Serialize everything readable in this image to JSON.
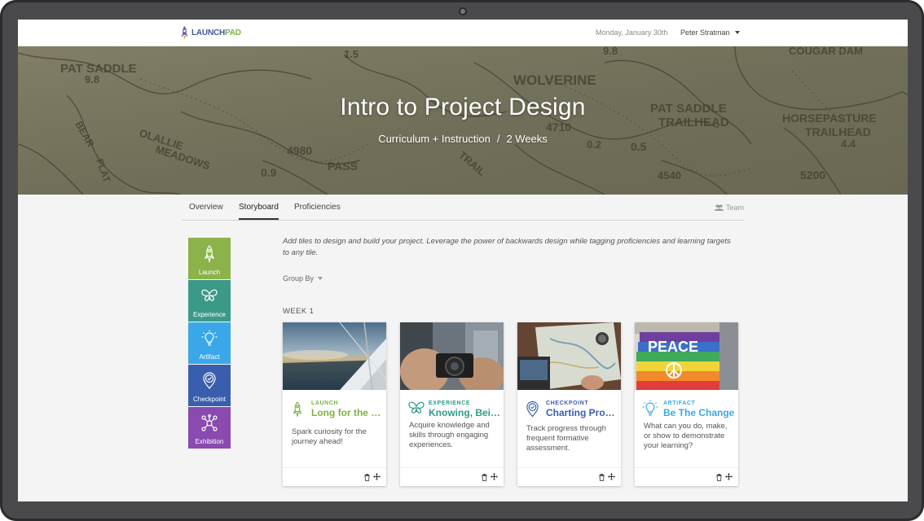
{
  "nav": {
    "logo_prefix": "LAUNCH",
    "logo_suffix": "PAD",
    "date": "Monday, January 30th",
    "user": "Peter Stratman"
  },
  "hero": {
    "title": "Intro to Project Design",
    "category": "Curriculum + Instruction",
    "separator": "/",
    "duration": "2 Weeks",
    "map_labels": [
      "PAT SADDLE",
      "9.8",
      "OLALLIE",
      "MEADOWS",
      "BEAR",
      "FLAT",
      "4980",
      "PASS",
      "0.9",
      "WOLVERINE",
      "4710",
      "0.2",
      "PAT SADDLE",
      "TRAILHEAD",
      "0.5",
      "4540",
      "HORSEPASTURE",
      "TRAILHEAD",
      "4.4",
      "5200",
      "COUGAR DAM",
      "1.5",
      "9.8",
      "TRAIL"
    ]
  },
  "tabs": {
    "items": [
      {
        "label": "Overview",
        "active": false
      },
      {
        "label": "Storyboard",
        "active": true
      },
      {
        "label": "Proficiencies",
        "active": false
      }
    ],
    "team_label": "Team"
  },
  "palette": [
    {
      "label": "Launch",
      "color": "#8bb34a",
      "icon": "rocket-icon"
    },
    {
      "label": "Experience",
      "color": "#3a9a87",
      "icon": "butterfly-icon"
    },
    {
      "label": "Artifact",
      "color": "#3aa8e8",
      "icon": "lightbulb-icon"
    },
    {
      "label": "Checkpoint",
      "color": "#3a5eae",
      "icon": "checkpoint-icon"
    },
    {
      "label": "Exhibition",
      "color": "#8a4ab0",
      "icon": "network-icon"
    }
  ],
  "main": {
    "intro": "Add tiles to design and build your project. Leverage the power of backwards design while tagging proficiencies and learning targets to any tile.",
    "group_by": "Group By",
    "week_label": "WEEK 1"
  },
  "cards": [
    {
      "type": "LAUNCH",
      "title": "Long for the S…",
      "description": "Spark curiosity for the journey ahead!",
      "color": "#7cb342",
      "icon": "rocket-icon",
      "image": "sailboat-photo"
    },
    {
      "type": "EXPERIENCE",
      "title": "Knowing, Bei…",
      "description": "Acquire knowledge and skills through engaging experiences.",
      "color": "#2e9a88",
      "icon": "butterfly-icon",
      "image": "camera-photo"
    },
    {
      "type": "CHECKPOINT",
      "title": "Charting Prog…",
      "description": "Track progress through frequent formative assessment.",
      "color": "#3a5eae",
      "icon": "checkpoint-icon",
      "image": "map-laptop-photo"
    },
    {
      "type": "ARTIFACT",
      "title": "Be The Change",
      "description": "What can you do, make, or show to demonstrate your learning?",
      "color": "#3aa8e8",
      "icon": "lightbulb-icon",
      "image": "peace-flag-photo"
    }
  ]
}
